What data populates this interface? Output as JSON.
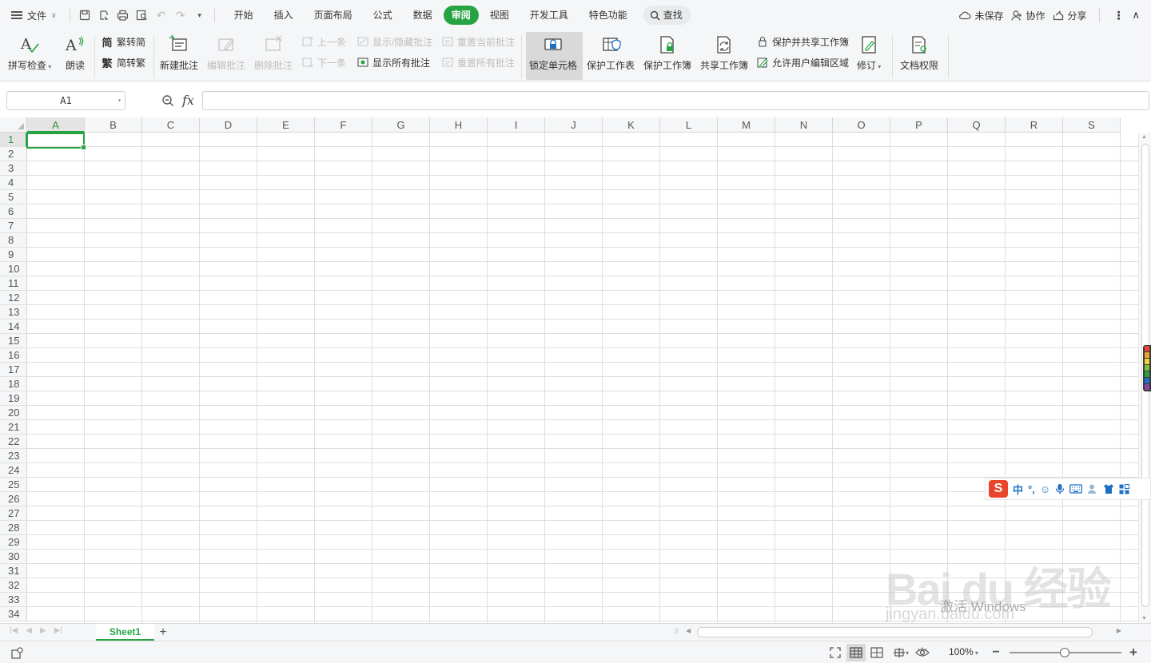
{
  "menubar": {
    "file_label": "文件",
    "tabs": [
      {
        "label": "开始"
      },
      {
        "label": "插入"
      },
      {
        "label": "页面布局"
      },
      {
        "label": "公式"
      },
      {
        "label": "数据"
      },
      {
        "label": "审阅",
        "active": true
      },
      {
        "label": "视图"
      },
      {
        "label": "开发工具"
      },
      {
        "label": "特色功能"
      }
    ],
    "search_label": "查找",
    "right": {
      "unsaved": "未保存",
      "collab": "协作",
      "share": "分享"
    }
  },
  "ribbon": {
    "spellcheck": "拼写检查",
    "read_aloud": "朗读",
    "trad_to_simp": "繁转简",
    "simp_to_trad": "简转繁",
    "new_comment": "新建批注",
    "edit_comment": "编辑批注",
    "delete_comment": "删除批注",
    "prev": "上一条",
    "next": "下一条",
    "show_hide_comment": "显示/隐藏批注",
    "show_all_comments": "显示所有批注",
    "reset_current_comment": "重置当前批注",
    "reset_all_comments": "重置所有批注",
    "lock_cell": "锁定单元格",
    "protect_sheet": "保护工作表",
    "protect_workbook": "保护工作簿",
    "share_workbook": "共享工作簿",
    "protect_and_share": "保护并共享工作簿",
    "allow_edit_ranges": "允许用户编辑区域",
    "track_changes": "修订",
    "doc_permissions": "文档权限"
  },
  "formula_bar": {
    "name_box": "A1",
    "fx": "fx",
    "value": ""
  },
  "grid": {
    "columns": [
      "A",
      "B",
      "C",
      "D",
      "E",
      "F",
      "G",
      "H",
      "I",
      "J",
      "K",
      "L",
      "M",
      "N",
      "O",
      "P",
      "Q",
      "R",
      "S"
    ],
    "rows": [
      "1",
      "2",
      "3",
      "4",
      "5",
      "6",
      "7",
      "8",
      "9",
      "10",
      "11",
      "12",
      "13",
      "14",
      "15",
      "16",
      "17",
      "18",
      "19",
      "20",
      "21",
      "22",
      "23",
      "24",
      "25",
      "26",
      "27",
      "28",
      "29",
      "30",
      "31",
      "32",
      "33",
      "34"
    ],
    "active_cell": "A1"
  },
  "ime": {
    "mode": "中",
    "punct": "°,"
  },
  "watermark": {
    "activate": "激活 Windows",
    "brand": "Bai du 经验",
    "site": "jingyan.baidu.com"
  },
  "sheets": {
    "tabs": [
      {
        "label": "Sheet1"
      }
    ],
    "add": "+"
  },
  "statusbar": {
    "zoom": "100%",
    "zoom_level": 1.0
  },
  "colors": {
    "accent": "#27a343",
    "ime_blue": "#1f6fc5",
    "ime_red": "#e8452c"
  }
}
